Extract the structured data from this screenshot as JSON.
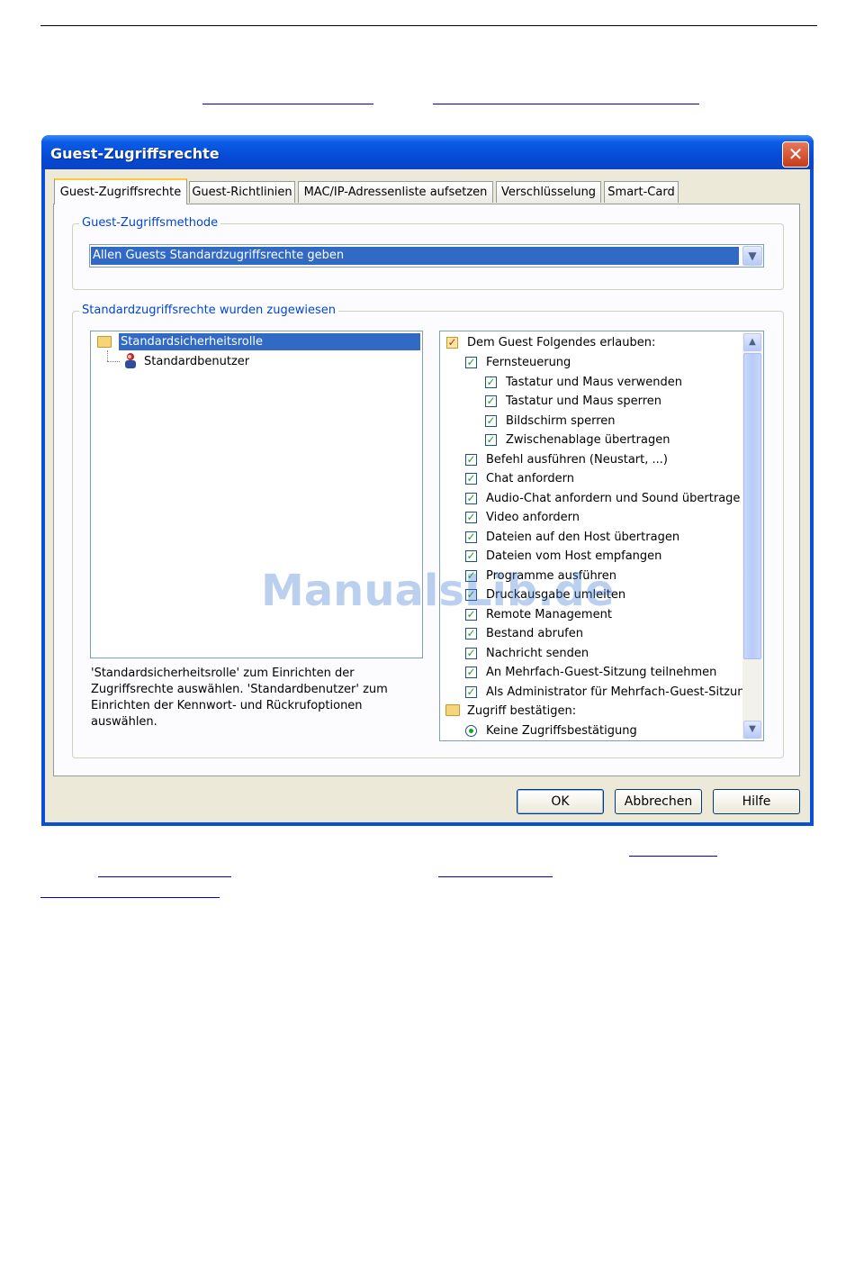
{
  "window": {
    "title": "Guest-Zugriffsrechte",
    "close_glyph": "✕"
  },
  "tabs": [
    {
      "label": "Guest-Zugriffsrechte",
      "active": true
    },
    {
      "label": "Guest-Richtlinien"
    },
    {
      "label": "MAC/IP-Adressenliste aufsetzen"
    },
    {
      "label": "Verschlüsselung"
    },
    {
      "label": "Smart-Card"
    }
  ],
  "access_method": {
    "group_label": "Guest-Zugriffsmethode",
    "selected": "Allen Guests Standardzugriffsrechte geben"
  },
  "assigned": {
    "group_label": "Standardzugriffsrechte wurden zugewiesen",
    "tree": {
      "role": "Standardsicherheitsrolle",
      "user": "Standardbenutzer"
    },
    "description": "'Standardsicherheitsrolle' zum Einrichten der Zugriffsrechte auswählen. 'Standardbenutzer' zum Einrichten der Kennwort- und Rückrufoptionen auswählen."
  },
  "permissions": {
    "header": "Dem Guest Folgendes erlauben:",
    "items": [
      {
        "label": "Fernsteuerung",
        "checked": true
      },
      {
        "label": "Tastatur und Maus verwenden",
        "checked": true
      },
      {
        "label": "Tastatur und Maus sperren",
        "checked": true
      },
      {
        "label": "Bildschirm sperren",
        "checked": true
      },
      {
        "label": "Zwischenablage übertragen",
        "checked": true
      },
      {
        "label": "Befehl ausführen (Neustart, ...)",
        "checked": true
      },
      {
        "label": "Chat anfordern",
        "checked": true
      },
      {
        "label": "Audio-Chat anfordern und Sound übertrage",
        "checked": true
      },
      {
        "label": "Video anfordern",
        "checked": true
      },
      {
        "label": "Dateien auf den Host übertragen",
        "checked": true
      },
      {
        "label": "Dateien vom Host empfangen",
        "checked": true
      },
      {
        "label": "Programme ausführen",
        "checked": true
      },
      {
        "label": "Druckausgabe umleiten",
        "checked": true
      },
      {
        "label": "Remote Management",
        "checked": true
      },
      {
        "label": "Bestand abrufen",
        "checked": true
      },
      {
        "label": "Nachricht senden",
        "checked": true
      },
      {
        "label": "An Mehrfach-Guest-Sitzung teilnehmen",
        "checked": true
      },
      {
        "label": "Als Administrator für Mehrfach-Guest-Sitzun",
        "checked": true
      }
    ],
    "confirm_header": "Zugriff bestätigen:",
    "confirm_option": "Keine Zugriffsbestätigung"
  },
  "buttons": {
    "ok": "OK",
    "cancel": "Abbrechen",
    "help": "Hilfe"
  },
  "watermark": "ManualsLib.de",
  "colors": {
    "title_bar": "#0548d4",
    "selection": "#316ac5",
    "group_label": "#0046d5",
    "check": "#21a121"
  }
}
